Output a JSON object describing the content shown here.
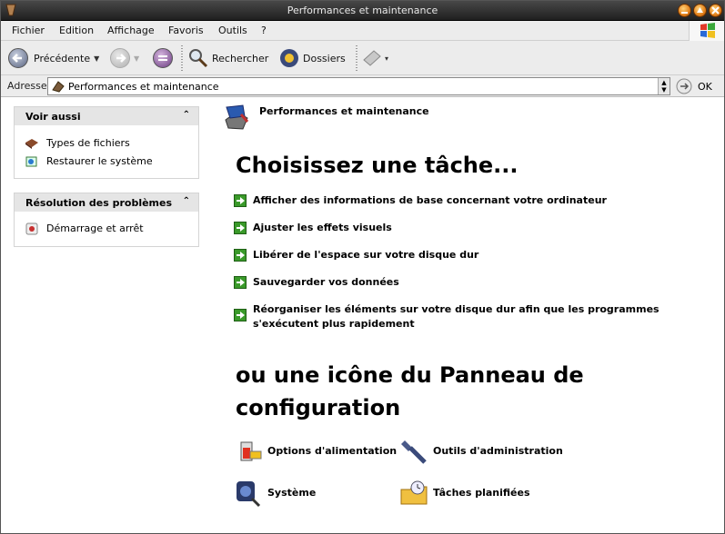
{
  "window": {
    "title": "Performances et maintenance"
  },
  "menu": {
    "items": [
      "Fichier",
      "Edition",
      "Affichage",
      "Favoris",
      "Outils",
      "?"
    ]
  },
  "toolbar": {
    "back_label": "Précédente",
    "search_label": "Rechercher",
    "folders_label": "Dossiers"
  },
  "address": {
    "label": "Adresse",
    "value": "Performances et maintenance",
    "go_label": "OK"
  },
  "sidebar": {
    "see_also": {
      "title": "Voir aussi",
      "items": [
        "Types de fichiers",
        "Restaurer le système"
      ]
    },
    "troubleshoot": {
      "title": "Résolution des problèmes",
      "items": [
        "Démarrage et arrêt"
      ]
    }
  },
  "main": {
    "header": "Performances et maintenance",
    "pick_task": "Choisissez une tâche...",
    "tasks": [
      "Afficher des informations de base concernant votre ordinateur",
      "Ajuster les effets visuels",
      "Libérer de l'espace sur votre disque dur",
      "Sauvegarder vos données",
      "Réorganiser les éléments sur votre disque dur afin que les programmes s'exécutent plus rapidement"
    ],
    "or_icon_line1": "ou une icône du Panneau de",
    "or_icon_line2": "configuration",
    "icons": [
      "Options d'alimentation",
      "Outils d'administration",
      "Système",
      "Tâches planifiées"
    ]
  },
  "colors": {
    "titlebar": "#2a2a2a",
    "accent_green": "#3a9a2a",
    "panel_header": "#e5e5e5"
  }
}
